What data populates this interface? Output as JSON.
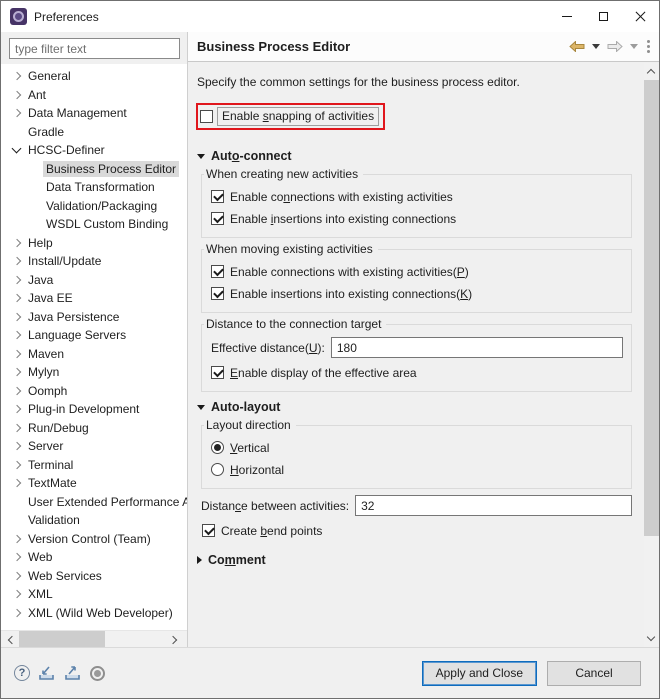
{
  "window": {
    "title": "Preferences"
  },
  "sidebar": {
    "filter_placeholder": "type filter text",
    "tree": [
      {
        "label": "General",
        "chevron": "collapsed",
        "indent": 0
      },
      {
        "label": "Ant",
        "chevron": "collapsed",
        "indent": 0
      },
      {
        "label": "Data Management",
        "chevron": "collapsed",
        "indent": 0
      },
      {
        "label": "Gradle",
        "chevron": "none",
        "indent": 0
      },
      {
        "label": "HCSC-Definer",
        "chevron": "expanded",
        "indent": 0
      },
      {
        "label": "Business Process Editor",
        "chevron": "none",
        "indent": 1,
        "selected": true
      },
      {
        "label": "Data Transformation",
        "chevron": "none",
        "indent": 1
      },
      {
        "label": "Validation/Packaging",
        "chevron": "none",
        "indent": 1
      },
      {
        "label": "WSDL Custom Binding",
        "chevron": "none",
        "indent": 1
      },
      {
        "label": "Help",
        "chevron": "collapsed",
        "indent": 0
      },
      {
        "label": "Install/Update",
        "chevron": "collapsed",
        "indent": 0
      },
      {
        "label": "Java",
        "chevron": "collapsed",
        "indent": 0
      },
      {
        "label": "Java EE",
        "chevron": "collapsed",
        "indent": 0
      },
      {
        "label": "Java Persistence",
        "chevron": "collapsed",
        "indent": 0
      },
      {
        "label": "Language Servers",
        "chevron": "collapsed",
        "indent": 0
      },
      {
        "label": "Maven",
        "chevron": "collapsed",
        "indent": 0
      },
      {
        "label": "Mylyn",
        "chevron": "collapsed",
        "indent": 0
      },
      {
        "label": "Oomph",
        "chevron": "collapsed",
        "indent": 0
      },
      {
        "label": "Plug-in Development",
        "chevron": "collapsed",
        "indent": 0
      },
      {
        "label": "Run/Debug",
        "chevron": "collapsed",
        "indent": 0
      },
      {
        "label": "Server",
        "chevron": "collapsed",
        "indent": 0
      },
      {
        "label": "Terminal",
        "chevron": "collapsed",
        "indent": 0
      },
      {
        "label": "TextMate",
        "chevron": "collapsed",
        "indent": 0
      },
      {
        "label": "User Extended Performance A",
        "chevron": "none",
        "indent": 0
      },
      {
        "label": "Validation",
        "chevron": "none",
        "indent": 0
      },
      {
        "label": "Version Control (Team)",
        "chevron": "collapsed",
        "indent": 0
      },
      {
        "label": "Web",
        "chevron": "collapsed",
        "indent": 0
      },
      {
        "label": "Web Services",
        "chevron": "collapsed",
        "indent": 0
      },
      {
        "label": "XML",
        "chevron": "collapsed",
        "indent": 0
      },
      {
        "label": "XML (Wild Web Developer)",
        "chevron": "collapsed",
        "indent": 0
      }
    ]
  },
  "content": {
    "page_title": "Business Process Editor",
    "description": "Specify the common settings for the business process editor.",
    "snapping": {
      "label": "Enable &snapping of activities",
      "checked": false
    },
    "auto_connect": {
      "title": "Aut&o-connect",
      "creating_group": {
        "title": "When creating new activities",
        "cb1": {
          "label": "Enable co&nnections with existing activities",
          "checked": true
        },
        "cb2": {
          "label": "Enable &insertions into existing connections",
          "checked": true
        }
      },
      "moving_group": {
        "title": "When moving existing activities",
        "cb1": {
          "label": "Enable connections with existing activities(&P)",
          "checked": true
        },
        "cb2": {
          "label": "Enable insertions into existing connections(&K)",
          "checked": true
        }
      },
      "distance_group": {
        "title": "Distance to the connection target",
        "field_label": "Effective distance(&U):",
        "field_value": "180",
        "cb": {
          "label": "&Enable display of the effective area",
          "checked": true
        }
      }
    },
    "auto_layout": {
      "title": "Auto-layout",
      "direction_group": {
        "title": "Layout direction",
        "radio1": {
          "label": "&Vertical",
          "selected": true
        },
        "radio2": {
          "label": "&Horizontal",
          "selected": false
        }
      },
      "distance_label": "Distan&ce between activities:",
      "distance_value": "32",
      "bend": {
        "label": "Create &bend points",
        "checked": true
      }
    },
    "comment": {
      "title": "Co&mment"
    }
  },
  "footer": {
    "help_glyph": "?",
    "apply_label": "Apply and Close",
    "cancel_label": "Cancel"
  },
  "colors": {
    "accent_blue": "#0f6cbd",
    "annotation_red": "#e0161c",
    "tree_selection_gray": "#d9d9d9",
    "back_arrow_gold": "#dcb567"
  }
}
